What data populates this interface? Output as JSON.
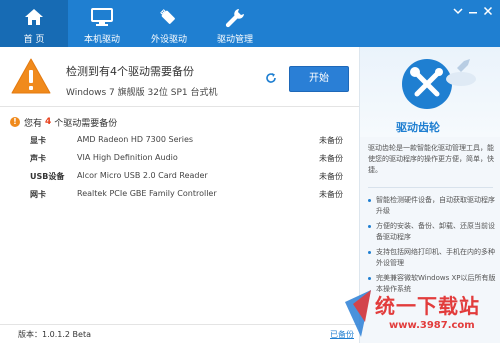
{
  "nav": {
    "tabs": [
      {
        "label": "首 页",
        "icon": "home-icon",
        "active": true
      },
      {
        "label": "本机驱动",
        "icon": "monitor-icon",
        "active": false
      },
      {
        "label": "外设驱动",
        "icon": "usb-drive-icon",
        "active": false
      },
      {
        "label": "驱动管理",
        "icon": "wrench-icon",
        "active": false
      }
    ],
    "window_buttons": [
      "menu-icon",
      "minimize-icon",
      "close-icon"
    ]
  },
  "hero": {
    "title": "检测到有4个驱动需要备份",
    "system": "Windows 7 旗舰版  32位 SP1 台式机",
    "start_label": "开始"
  },
  "pending": {
    "prefix": "您有",
    "count": "4",
    "suffix": "个驱动需要备份"
  },
  "drivers": [
    {
      "category": "显卡",
      "name": "AMD Radeon HD 7300 Series",
      "status": "未备份"
    },
    {
      "category": "声卡",
      "name": "VIA High Definition Audio",
      "status": "未备份"
    },
    {
      "category": "USB设备",
      "name": "Alcor Micro USB 2.0 Card Reader",
      "status": "未备份"
    },
    {
      "category": "网卡",
      "name": "Realtek PCIe GBE Family Controller",
      "status": "未备份"
    }
  ],
  "footer": {
    "version": "版本：1.0.1.2 Beta",
    "link": "已备份"
  },
  "side": {
    "title": "驱动齿轮",
    "description": "驱动齿轮是一款智能化驱动管理工具，能使您的驱动程序的操作更方便，简单，快捷。",
    "features": [
      "智能检测硬件设备，自动获取驱动程序升级",
      "方便的安装、备份、卸载、还原当前设备驱动程序",
      "支持包括网络打印机、手机在内的多种外设管理",
      "完美兼容微软Windows XP以后所有版本操作系统"
    ]
  },
  "watermark": {
    "title": "统一下载站",
    "url": "www.3987.com"
  },
  "colors": {
    "topbar": "#1f7fd1",
    "active_tab": "#176bb4",
    "warning": "#f08a1c",
    "start_button": "#2a7fd6",
    "accent_red": "#e23c3c"
  }
}
